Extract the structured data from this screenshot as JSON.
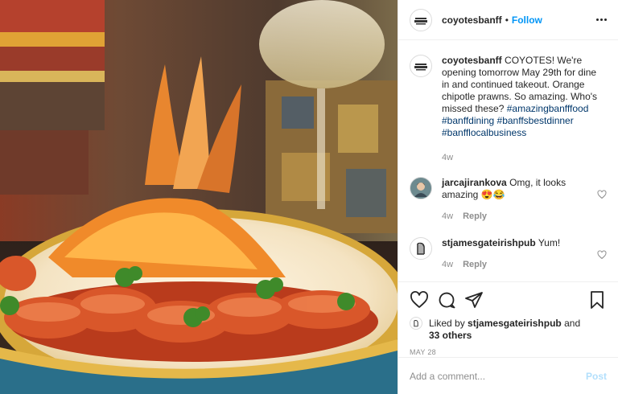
{
  "post": {
    "author": "coyotesbanff",
    "follow_label": "Follow",
    "dot": "•",
    "caption_text": "COYOTES! We're opening tomorrow May 29th for dine in and continued takeout. Orange chipotle prawns. So amazing. Who's missed these?",
    "hashtags": [
      "#amazingbanfffood",
      "#banffdining",
      "#banffsbestdinner",
      "#banfflocalbusiness"
    ],
    "caption_age": "4w",
    "image_alt": "Orange chipotle prawns on a plate with orange slices and crispy garnish, wine glass in background"
  },
  "comments": [
    {
      "user": "jarcajirankova",
      "text": "Omg, it looks amazing 😍😂",
      "age": "4w",
      "reply_label": "Reply"
    },
    {
      "user": "stjamesgateirishpub",
      "text": "Yum!",
      "age": "4w",
      "reply_label": "Reply"
    }
  ],
  "likes": {
    "prefix": "Liked by",
    "user": "stjamesgateirishpub",
    "and": "and",
    "others": "33 others"
  },
  "date": "MAY 28",
  "add_comment": {
    "placeholder": "Add a comment...",
    "post_label": "Post"
  },
  "icons": {
    "more": "more-options-icon",
    "like": "heart-icon",
    "comment": "comment-icon",
    "share": "share-icon",
    "save": "bookmark-icon"
  },
  "colors": {
    "link": "#0095f6",
    "hashtag": "#00376b",
    "muted": "#8e8e8e",
    "post_disabled": "#b2dffc"
  }
}
